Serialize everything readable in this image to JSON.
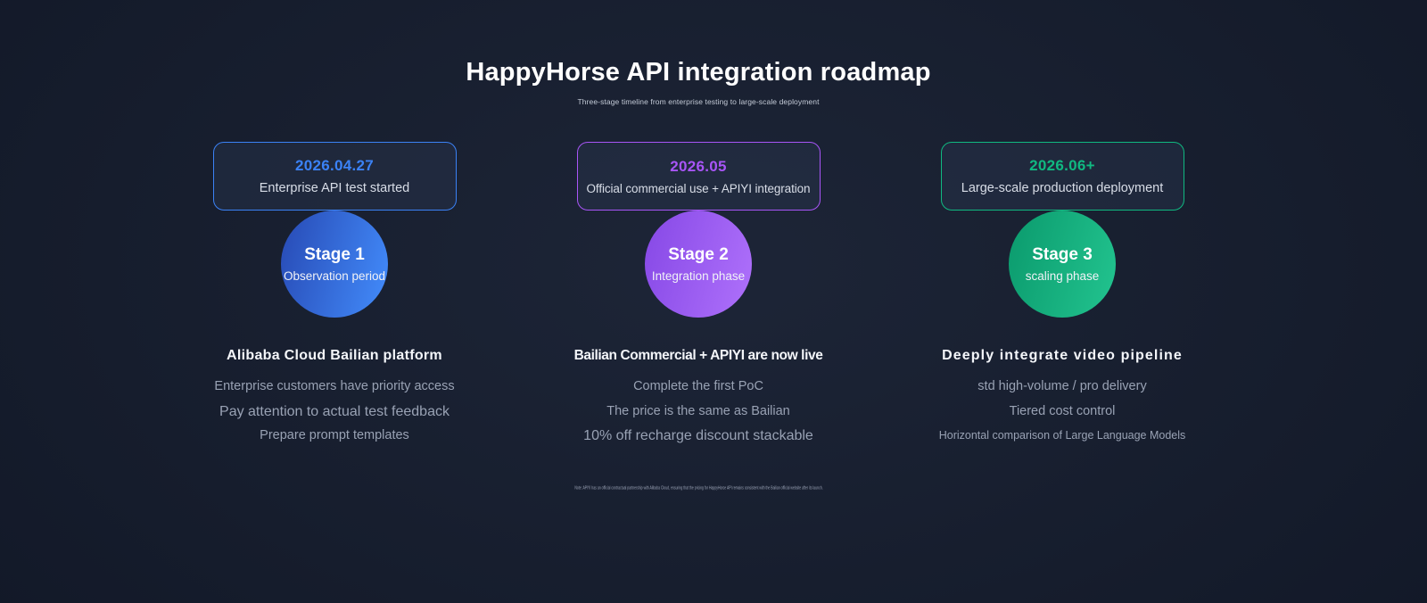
{
  "page": {
    "title": "HappyHorse API integration roadmap",
    "subtitle": "Three-stage timeline from enterprise testing to large-scale deployment",
    "footnote": "Note: APIYI has an official contractual partnership with Alibaba Cloud, ensuring that the pricing for HappyHorse API remains consistent with the Bailian official website after its launch."
  },
  "colors": {
    "background": "#161d2d",
    "stage1_accent": "#3b82f6",
    "stage2_accent": "#a855f7",
    "stage3_accent": "#10b981",
    "stage1_circle_gradient": [
      "#2a50bb",
      "#4086f5"
    ],
    "stage2_circle_gradient": [
      "#8a4ce8",
      "#ab6df9"
    ],
    "stage3_circle_gradient": [
      "#0d9e70",
      "#20c08c"
    ],
    "heading_text": "#f4f6fa",
    "body_text": "#99a2b4"
  },
  "stages": [
    {
      "date": "2026.04.27",
      "milestone": "Enterprise API test started",
      "stage_label": "Stage 1",
      "stage_sublabel": "Observation period",
      "heading": "Alibaba Cloud Bailian platform",
      "points": [
        "Enterprise customers have priority access",
        "Pay attention to actual test feedback",
        "Prepare prompt templates"
      ]
    },
    {
      "date": "2026.05",
      "milestone": "Official commercial use + APIYI integration",
      "stage_label": "Stage 2",
      "stage_sublabel": "Integration phase",
      "heading": "Bailian Commercial + APIYI are now live",
      "points": [
        "Complete the first PoC",
        "The price is the same as Bailian",
        "10% off recharge discount stackable"
      ]
    },
    {
      "date": "2026.06+",
      "milestone": "Large-scale production deployment",
      "stage_label": "Stage 3",
      "stage_sublabel": "scaling phase",
      "heading": "Deeply integrate video pipeline",
      "points": [
        "std high-volume / pro delivery",
        "Tiered cost control",
        "Horizontal comparison of Large Language Models"
      ]
    }
  ]
}
